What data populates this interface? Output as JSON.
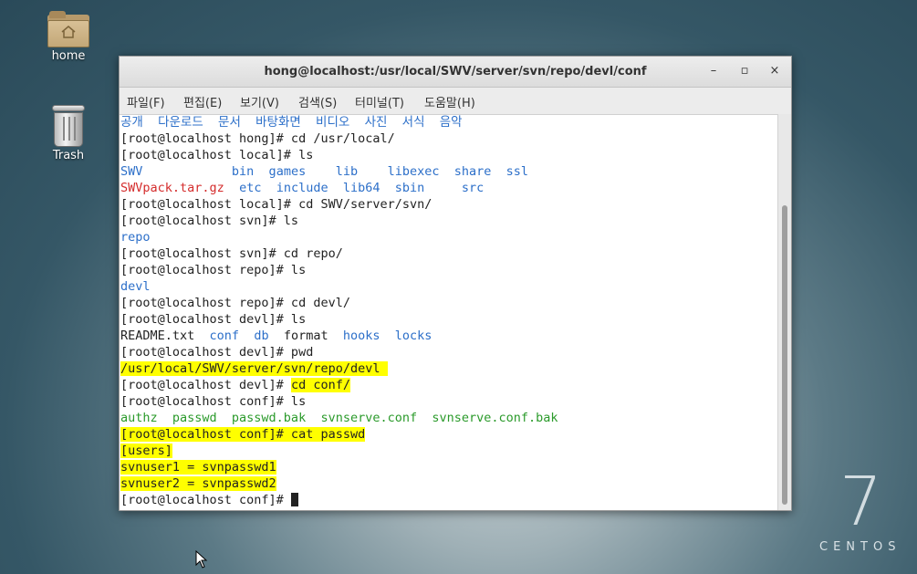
{
  "desktop": {
    "icons": [
      {
        "label": "home",
        "icon": "home-folder-icon"
      },
      {
        "label": "Trash",
        "icon": "trash-icon"
      }
    ],
    "logo": {
      "number": "7",
      "word": "CENTOS"
    }
  },
  "window": {
    "title": "hong@localhost:/usr/local/SWV/server/svn/repo/devl/conf",
    "controls": {
      "minimize": "–",
      "maximize": "▫",
      "close": "×"
    },
    "menu": [
      "파일(F)",
      "편집(E)",
      "보기(V)",
      "검색(S)",
      "터미널(T)",
      "도움말(H)"
    ]
  },
  "terminal": {
    "lines": [
      [
        {
          "t": "공개  다운로드  문서  바탕화면  비디오  사진  서식  음악",
          "c": "blue"
        }
      ],
      [
        {
          "t": "[root@localhost hong]# cd /usr/local/"
        }
      ],
      [
        {
          "t": "[root@localhost local]# ls"
        }
      ],
      [
        {
          "t": "SWV            ",
          "c": "blue"
        },
        {
          "t": "bin  games    lib    libexec  share  ssl",
          "c": "blue"
        }
      ],
      [
        {
          "t": "SWVpack.tar.gz",
          "c": "red"
        },
        {
          "t": "  "
        },
        {
          "t": "etc  include  lib64  sbin     src",
          "c": "blue"
        }
      ],
      [
        {
          "t": "[root@localhost local]# cd SWV/server/svn/"
        }
      ],
      [
        {
          "t": "[root@localhost svn]# ls"
        }
      ],
      [
        {
          "t": "repo",
          "c": "blue"
        }
      ],
      [
        {
          "t": "[root@localhost svn]# cd repo/"
        }
      ],
      [
        {
          "t": "[root@localhost repo]# ls"
        }
      ],
      [
        {
          "t": "devl",
          "c": "blue"
        }
      ],
      [
        {
          "t": "[root@localhost repo]# cd devl/"
        }
      ],
      [
        {
          "t": "[root@localhost devl]# ls"
        }
      ],
      [
        {
          "t": "README.txt  "
        },
        {
          "t": "conf  db",
          "c": "blue"
        },
        {
          "t": "  format  "
        },
        {
          "t": "hooks  locks",
          "c": "blue"
        }
      ],
      [
        {
          "t": "[root@localhost devl]# pwd"
        }
      ],
      [
        {
          "t": "/usr/local/SWV/server/svn/repo/devl ",
          "h": true
        }
      ],
      [
        {
          "t": "[root@localhost devl]# "
        },
        {
          "t": "cd conf/",
          "h": true
        }
      ],
      [
        {
          "t": "[root@localhost conf]# ls"
        }
      ],
      [
        {
          "t": "authz  passwd  passwd.bak  svnserve.conf  svnserve.conf.bak",
          "c": "green"
        }
      ],
      [
        {
          "t": "[root@localhost conf]# cat passwd",
          "h": true
        }
      ],
      [
        {
          "t": "[users]",
          "h": true
        }
      ],
      [
        {
          "t": "svnuser1 = svnpasswd1",
          "h": true
        }
      ],
      [
        {
          "t": "svnuser2 = svnpasswd2",
          "h": true
        }
      ],
      [
        {
          "t": "[root@localhost conf]# "
        }
      ]
    ]
  }
}
